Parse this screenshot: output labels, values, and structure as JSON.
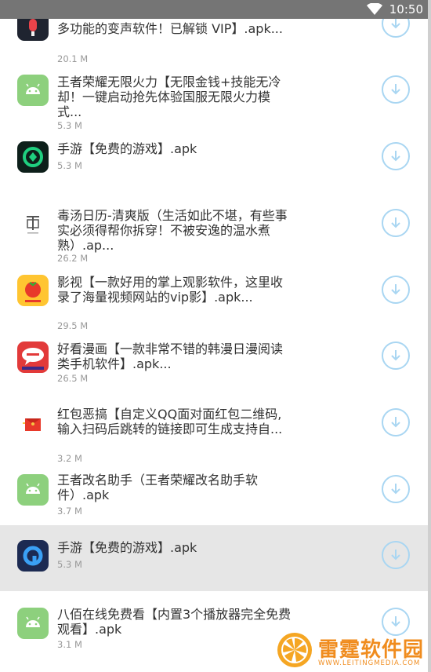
{
  "status_bar": {
    "time": "10:50",
    "wifi_icon": "wifi-icon"
  },
  "items": [
    {
      "title": "多功能的变声软件！已解锁 VIP】.apk...",
      "size": "20.1 M",
      "icon": "voice-changer-icon",
      "action_icon": "download-icon"
    },
    {
      "title": "王者荣耀无限火力【无限金钱+技能无冷却！一键启动抢先体验国服无限火力模式...",
      "size": "5.3 M",
      "icon": "android-icon",
      "action_icon": "download-icon"
    },
    {
      "title": "手游【免费的游戏】.apk",
      "size": "5.3 M",
      "icon": "game-app-icon",
      "action_icon": "download-icon"
    },
    {
      "title": "毒汤日历-清爽版（生活如此不堪，有些事实必须得帮你拆穿！不被安逸的温水煮熟）.ap...",
      "size": "26.2 M",
      "icon": "calendar-app-icon",
      "action_icon": "download-icon"
    },
    {
      "title": "影视【一款好用的掌上观影软件，这里收录了海量视频网站的vip影】.apk...",
      "size": "29.5 M",
      "icon": "tomato-video-icon",
      "action_icon": "download-icon"
    },
    {
      "title": "好看漫画【一款非常不错的韩漫日漫阅读类手机软件】.apk...",
      "size": "26.5 M",
      "icon": "comic-app-icon",
      "action_icon": "download-icon"
    },
    {
      "title": "红包恶搞【自定义QQ面对面红包二维码,输入扫码后跳转的链接即可生成支持自...",
      "size": "3.2 M",
      "icon": "red-envelope-icon",
      "action_icon": "download-icon"
    },
    {
      "title": "王者改名助手（王者荣耀改名助手软件）.apk",
      "size": "3.7 M",
      "icon": "android-icon",
      "action_icon": "download-icon"
    },
    {
      "title": "手游【免费的游戏】.apk",
      "size": "5.3 M",
      "icon": "game-app-icon-blue",
      "action_icon": "download-icon"
    },
    {
      "title": "八佰在线免费看【内置3个播放器完全免费观看】.apk",
      "size": "3.1 M",
      "icon": "android-icon",
      "action_icon": "download-icon"
    }
  ],
  "watermark": {
    "name": "雷霆软件园",
    "url": "WWW.LEITINGMEDIA.COM",
    "icon": "orange-slice-logo-icon"
  },
  "colors": {
    "accent": "#a9d6f2",
    "android_green": "#8dd07d",
    "watermark": "#f08c1e",
    "status_bar": "#757575"
  }
}
